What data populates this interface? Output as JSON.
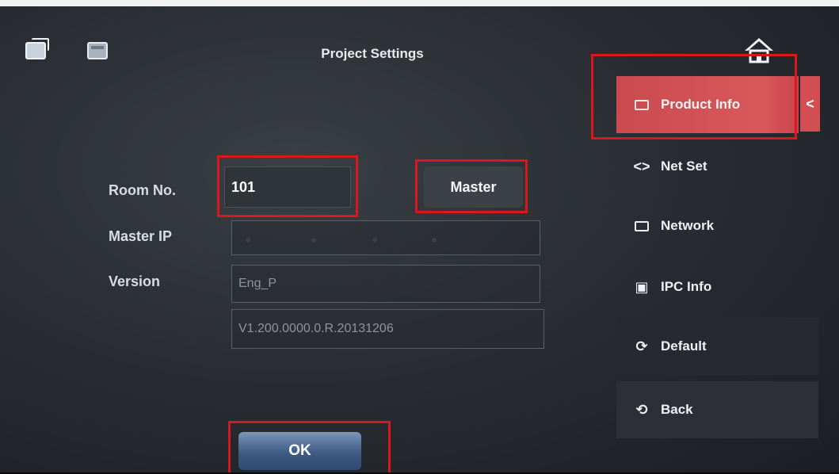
{
  "header": {
    "title": "Project Settings"
  },
  "form": {
    "room_label": "Room No.",
    "room_value": "101",
    "master_button": "Master",
    "master_ip_label": "Master IP",
    "version_label": "Version",
    "version_field_1": "Eng_P",
    "version_field_2": "V1.200.0000.0.R.20131206",
    "ok_button": "OK"
  },
  "sidebar": {
    "items": [
      {
        "label": "Product Info",
        "icon": "info-card-icon",
        "active": true
      },
      {
        "label": "Net Set",
        "icon": "code-brackets-icon"
      },
      {
        "label": "Network",
        "icon": "network-card-icon"
      },
      {
        "label": "IPC Info",
        "icon": "camera-icon"
      },
      {
        "label": "Default",
        "icon": "reset-icon"
      },
      {
        "label": "Back",
        "icon": "back-arrow-icon"
      }
    ]
  },
  "colors": {
    "active_tab": "#d9585c",
    "highlight_box": "#d8181d",
    "ok_button": "#3e5b85"
  }
}
